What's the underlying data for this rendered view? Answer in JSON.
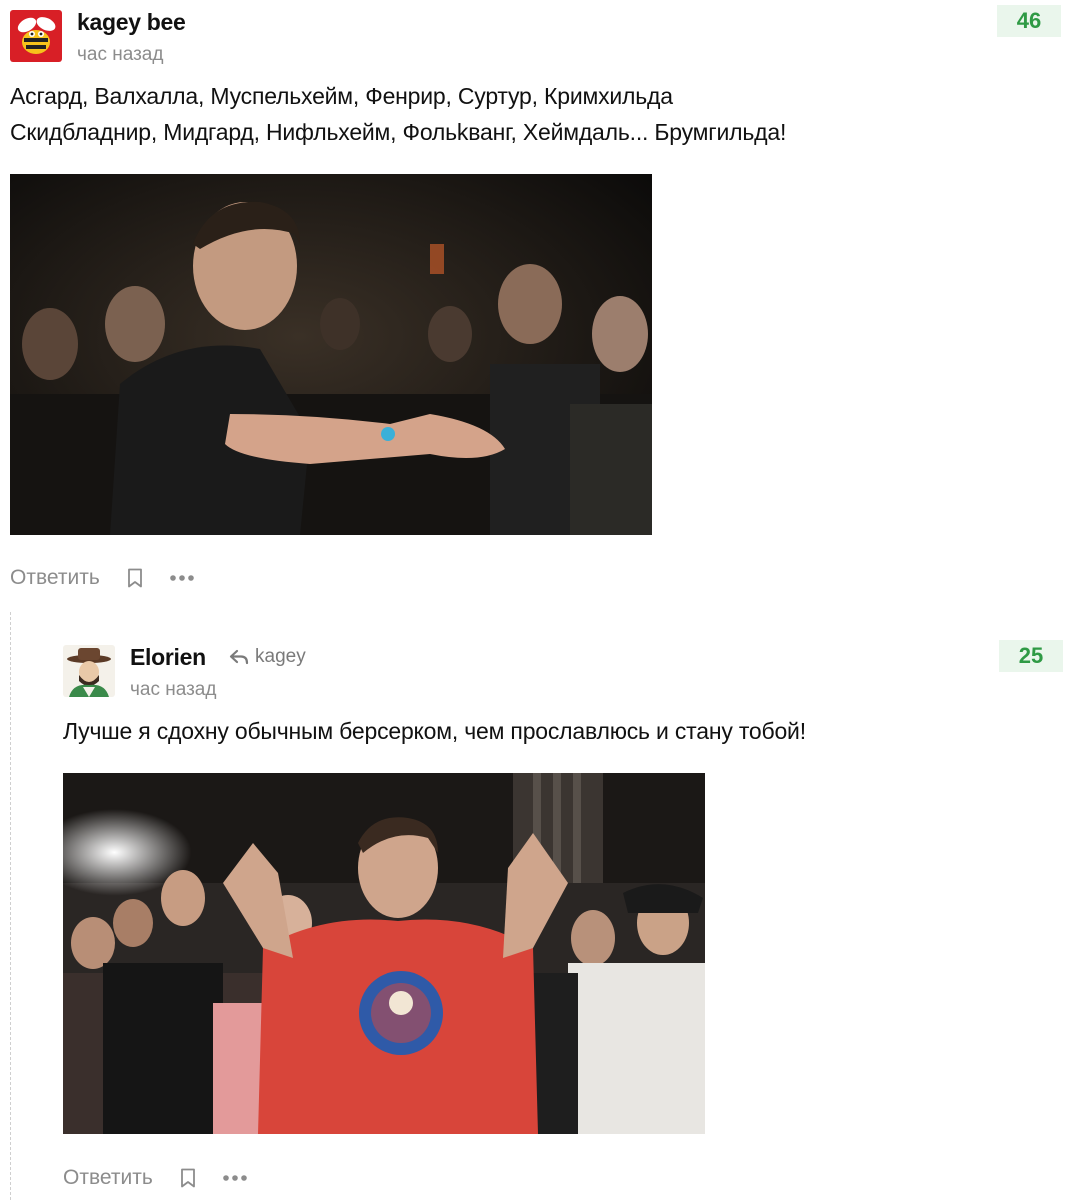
{
  "comments": [
    {
      "author": "kagey bee",
      "time": "час назад",
      "rating": "46",
      "text_lines": [
        "Асгард, Валхалла, Муспельхейм, Фенрир, Суртур, Кримхильда",
        "Скидбладнир, Мидгард, Нифльхейм, Фольkванг, Хеймдаль... Брумгильда!"
      ],
      "reply_label": "Ответить",
      "avatar_icon": "bee-avatar-icon",
      "image_icon": "battle-photo-man-gesturing"
    },
    {
      "author": "Elorien",
      "reply_to": "kagey",
      "time": "час назад",
      "rating": "25",
      "text_lines": [
        "Лучше я сдохну обычным берсерком, чем прославлюсь и стану тобой!"
      ],
      "reply_label": "Ответить",
      "avatar_icon": "cowboy-avatar-icon",
      "image_icon": "battle-photo-man-red-shirt"
    }
  ],
  "colors": {
    "rating_bg": "#eaf6ec",
    "rating_text": "#2f9a45",
    "muted": "#8c8c8c"
  }
}
